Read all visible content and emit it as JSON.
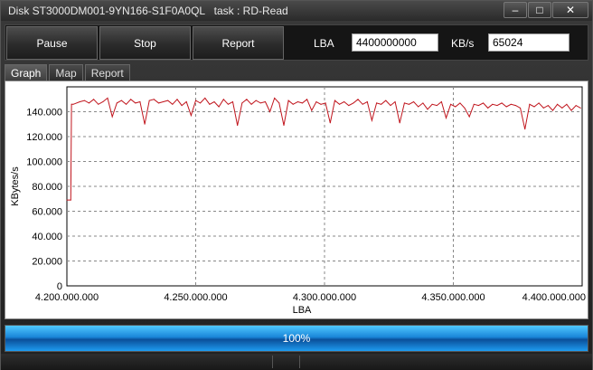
{
  "window": {
    "title": "Disk ST3000DM001-9YN166-S1F0A0QL   task : RD-Read",
    "minimize_glyph": "–",
    "maximize_glyph": "□",
    "close_glyph": "✕"
  },
  "toolbar": {
    "pause_label": "Pause",
    "stop_label": "Stop",
    "report_label": "Report",
    "lba_label": "LBA",
    "lba_value": "4400000000",
    "kbs_label": "KB/s",
    "kbs_value": "65024"
  },
  "tabs": [
    {
      "label": "Graph",
      "active": true
    },
    {
      "label": "Map",
      "active": false
    },
    {
      "label": "Report",
      "active": false
    }
  ],
  "chart_data": {
    "type": "line",
    "title": "",
    "xlabel": "LBA",
    "ylabel": "KBytes/s",
    "xlim": [
      4200000000,
      4400000000
    ],
    "ylim": [
      0,
      160000
    ],
    "x_ticks": [
      4200000000,
      4250000000,
      4300000000,
      4350000000,
      4400000000
    ],
    "x_tick_labels": [
      "4.200.000.000",
      "4.250.000.000",
      "4.300.000.000",
      "4.350.000.000",
      "4.400.000.000"
    ],
    "y_ticks": [
      0,
      20000,
      40000,
      60000,
      80000,
      100000,
      120000,
      140000
    ],
    "y_tick_labels": [
      "0",
      "20.000",
      "40.000",
      "60.000",
      "80.000",
      "100.000",
      "120.000",
      "140.000"
    ],
    "grid": true,
    "line_color": "#c0141c",
    "series": [
      {
        "name": "",
        "x": [
          4197000000,
          4201500000,
          4201800000,
          4202500000,
          4205000000,
          4206800000,
          4208600000,
          4210400000,
          4212200000,
          4214000000,
          4215800000,
          4217600000,
          4219400000,
          4221200000,
          4223000000,
          4224800000,
          4226600000,
          4228400000,
          4230200000,
          4232000000,
          4233800000,
          4235600000,
          4237400000,
          4239200000,
          4241000000,
          4242800000,
          4244600000,
          4246400000,
          4248200000,
          4250000000,
          4251800000,
          4253600000,
          4255400000,
          4257200000,
          4259000000,
          4260800000,
          4262600000,
          4264400000,
          4266200000,
          4268000000,
          4269800000,
          4271600000,
          4273400000,
          4275200000,
          4277000000,
          4278800000,
          4280600000,
          4282400000,
          4284200000,
          4286000000,
          4287800000,
          4289600000,
          4291400000,
          4293200000,
          4295000000,
          4296800000,
          4298600000,
          4300400000,
          4302200000,
          4304000000,
          4305800000,
          4307600000,
          4309400000,
          4311200000,
          4313000000,
          4314800000,
          4316600000,
          4318400000,
          4320200000,
          4322000000,
          4323800000,
          4325600000,
          4327400000,
          4329200000,
          4331000000,
          4332800000,
          4334600000,
          4336400000,
          4338200000,
          4340000000,
          4341800000,
          4343600000,
          4345400000,
          4347200000,
          4349000000,
          4350800000,
          4352600000,
          4354400000,
          4356200000,
          4358000000,
          4359800000,
          4361600000,
          4363400000,
          4365200000,
          4367000000,
          4368800000,
          4370600000,
          4372400000,
          4374200000,
          4376000000,
          4377800000,
          4379600000,
          4381400000,
          4383200000,
          4385000000,
          4386800000,
          4388600000,
          4390400000,
          4392200000,
          4394000000,
          4395800000,
          4397600000,
          4399400000
        ],
        "values": [
          69000,
          69000,
          146000,
          146000,
          148000,
          149000,
          147000,
          150000,
          146000,
          148000,
          151000,
          136000,
          147000,
          149000,
          146000,
          150000,
          147000,
          148000,
          130000,
          149000,
          150000,
          147000,
          148000,
          149000,
          146000,
          150000,
          145000,
          148000,
          137000,
          149000,
          147000,
          151000,
          146000,
          148000,
          144000,
          150000,
          146000,
          148000,
          129000,
          147000,
          150000,
          146000,
          149000,
          147000,
          148000,
          140000,
          151000,
          147000,
          129000,
          149000,
          146000,
          148000,
          147000,
          150000,
          141000,
          148000,
          146000,
          147000,
          131000,
          149000,
          146000,
          148000,
          145000,
          147000,
          150000,
          146000,
          148000,
          133000,
          147000,
          146000,
          149000,
          145000,
          148000,
          131000,
          147000,
          146000,
          148000,
          144000,
          147000,
          142000,
          146000,
          145000,
          148000,
          135000,
          146000,
          144000,
          147000,
          143000,
          136000,
          146000,
          145000,
          147000,
          143000,
          146000,
          145000,
          147000,
          144000,
          146000,
          145000,
          143000,
          126000,
          146000,
          144000,
          147000,
          143000,
          145000,
          141000,
          146000,
          143000,
          146000,
          141000,
          145000,
          143000
        ]
      }
    ]
  },
  "progress": {
    "value": 1.0,
    "label": "100%"
  }
}
